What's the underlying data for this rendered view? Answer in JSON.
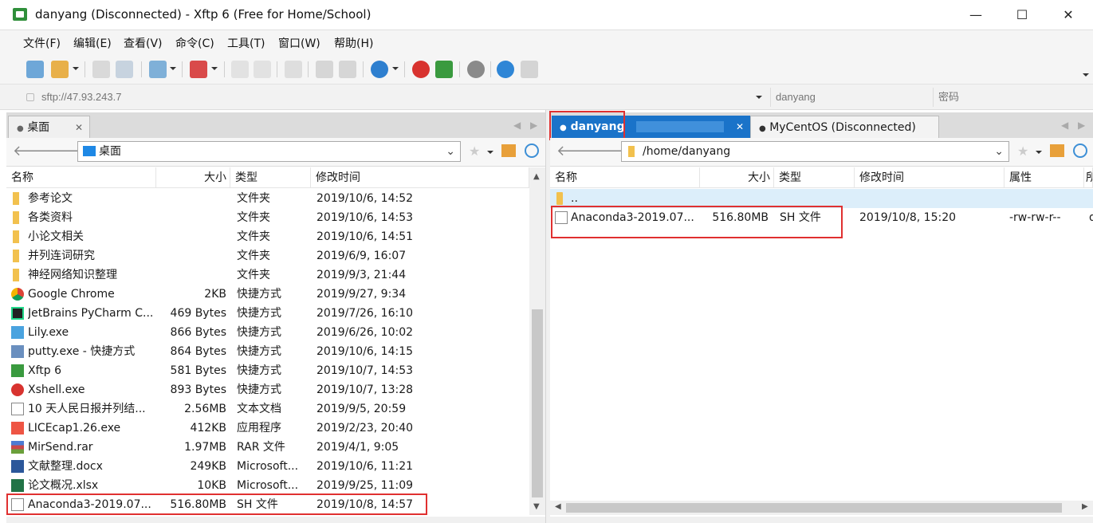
{
  "window": {
    "title": "danyang (Disconnected) - Xftp 6 (Free for Home/School)",
    "minimize": "—",
    "maximize": "☐",
    "close": "✕"
  },
  "menu": [
    "文件(F)",
    "编辑(E)",
    "查看(V)",
    "命令(C)",
    "工具(T)",
    "窗口(W)",
    "帮助(H)"
  ],
  "toolbar_icons": [
    "new-session-icon",
    "open-folder-icon",
    "disconnect-icon",
    "reconnect-icon",
    "view-icon",
    "terminal-icon",
    "copy-icon",
    "paste-icon",
    "transfer-icon",
    "upload-icon",
    "download-icon",
    "globe-icon",
    "xshell-icon",
    "xftp-icon",
    "settings-icon",
    "help-icon",
    "chat-icon"
  ],
  "address": {
    "url_placeholder": "sftp://47.93.243.7",
    "user_placeholder": "danyang",
    "password_placeholder": "密码"
  },
  "left": {
    "tab": "桌面",
    "path": "桌面",
    "headers": [
      "名称",
      "大小",
      "类型",
      "修改时间"
    ],
    "rows": [
      {
        "icon": "folder",
        "name": "参考论文",
        "size": "",
        "type": "文件夹",
        "mtime": "2019/10/6, 14:52"
      },
      {
        "icon": "folder",
        "name": "各类资料",
        "size": "",
        "type": "文件夹",
        "mtime": "2019/10/6, 14:53"
      },
      {
        "icon": "folder",
        "name": "小论文相关",
        "size": "",
        "type": "文件夹",
        "mtime": "2019/10/6, 14:51"
      },
      {
        "icon": "folder",
        "name": "并列连词研究",
        "size": "",
        "type": "文件夹",
        "mtime": "2019/6/9, 16:07"
      },
      {
        "icon": "folder",
        "name": "神经网络知识整理",
        "size": "",
        "type": "文件夹",
        "mtime": "2019/9/3, 21:44"
      },
      {
        "icon": "chrome",
        "name": "Google Chrome",
        "size": "2KB",
        "type": "快捷方式",
        "mtime": "2019/9/27, 9:34"
      },
      {
        "icon": "pycharm",
        "name": "JetBrains PyCharm C...",
        "size": "469 Bytes",
        "type": "快捷方式",
        "mtime": "2019/7/26, 16:10"
      },
      {
        "icon": "lily",
        "name": "Lily.exe",
        "size": "866 Bytes",
        "type": "快捷方式",
        "mtime": "2019/6/26, 10:02"
      },
      {
        "icon": "putty",
        "name": "putty.exe - 快捷方式",
        "size": "864 Bytes",
        "type": "快捷方式",
        "mtime": "2019/10/6, 14:15"
      },
      {
        "icon": "xftp",
        "name": "Xftp 6",
        "size": "581 Bytes",
        "type": "快捷方式",
        "mtime": "2019/10/7, 14:53"
      },
      {
        "icon": "xshell",
        "name": "Xshell.exe",
        "size": "893 Bytes",
        "type": "快捷方式",
        "mtime": "2019/10/7, 13:28"
      },
      {
        "icon": "doc",
        "name": "10 天人民日报并列结...",
        "size": "2.56MB",
        "type": "文本文档",
        "mtime": "2019/9/5, 20:59"
      },
      {
        "icon": "licecap",
        "name": "LICEcap1.26.exe",
        "size": "412KB",
        "type": "应用程序",
        "mtime": "2019/2/23, 20:40"
      },
      {
        "icon": "rar",
        "name": "MirSend.rar",
        "size": "1.97MB",
        "type": "RAR 文件",
        "mtime": "2019/4/1, 9:05"
      },
      {
        "icon": "word",
        "name": "文献整理.docx",
        "size": "249KB",
        "type": "Microsoft...",
        "mtime": "2019/10/6, 11:21"
      },
      {
        "icon": "excel",
        "name": "论文概况.xlsx",
        "size": "10KB",
        "type": "Microsoft...",
        "mtime": "2019/9/25, 11:09"
      },
      {
        "icon": "doc",
        "name": "Anaconda3-2019.07...",
        "size": "516.80MB",
        "type": "SH 文件",
        "mtime": "2019/10/8, 14:57"
      }
    ]
  },
  "right": {
    "tab_active": "danyang",
    "tab_other": "MyCentOS (Disconnected)",
    "path": "/home/danyang",
    "headers": [
      "名称",
      "大小",
      "类型",
      "修改时间",
      "属性",
      "所"
    ],
    "parent_row": "..",
    "rows": [
      {
        "icon": "doc",
        "name": "Anaconda3-2019.07...",
        "size": "516.80MB",
        "type": "SH 文件",
        "mtime": "2019/10/8, 15:20",
        "attr": "-rw-rw-r--",
        "owner": "d"
      }
    ]
  },
  "colors": {
    "highlight": "#e03030",
    "active_tab": "#1a73c9",
    "parent_row_bg": "#dceefa"
  }
}
